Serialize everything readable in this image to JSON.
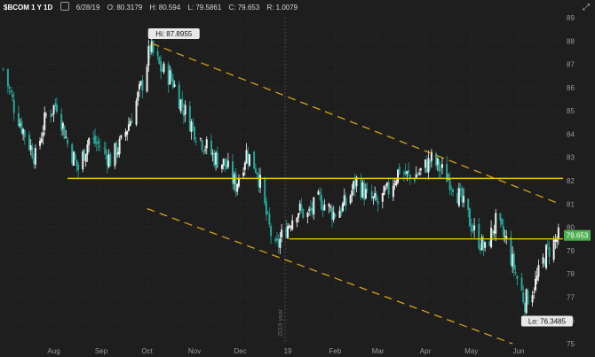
{
  "header": {
    "symbol": "$BCOM 1 Y 1D",
    "date": "6/28/19",
    "open": "O: 80.3179",
    "high": "H: 80.594",
    "low": "L: 79.5861",
    "close": "C: 79.653",
    "range": "R: 1.0079"
  },
  "colors": {
    "background": "#1e1e1e",
    "up": "#f0f0f0",
    "down": "#26a69a",
    "trendline": "#d4a017",
    "support": "#e6c200",
    "grid": "#3a3a3a",
    "price_tag": "#4caf50"
  },
  "chart_data": {
    "type": "candlestick",
    "title": "$BCOM 1 Y 1D",
    "ylim": [
      75,
      89
    ],
    "y_ticks": [
      75,
      76,
      77,
      78,
      79,
      80,
      81,
      82,
      83,
      84,
      85,
      86,
      87,
      88,
      89
    ],
    "x_labels": [
      {
        "label": "Aug",
        "date": "2018-08-01"
      },
      {
        "label": "Sep",
        "date": "2018-09-01"
      },
      {
        "label": "Oct",
        "date": "2018-10-01"
      },
      {
        "label": "Nov",
        "date": "2018-11-01"
      },
      {
        "label": "Dec",
        "date": "2018-12-01"
      },
      {
        "label": "19",
        "date": "2019-01-01"
      },
      {
        "label": "Feb",
        "date": "2019-02-01"
      },
      {
        "label": "Mar",
        "date": "2019-03-01"
      },
      {
        "label": "Apr",
        "date": "2019-04-01"
      },
      {
        "label": "May",
        "date": "2019-05-01"
      },
      {
        "label": "Jun",
        "date": "2019-06-01"
      }
    ],
    "year_marker": {
      "label": "2019 year",
      "date": "2019-01-01"
    },
    "price_path": [
      [
        "2018-06-29",
        86.8
      ],
      [
        "2018-07-06",
        85.2
      ],
      [
        "2018-07-13",
        84.0
      ],
      [
        "2018-07-20",
        83.0
      ],
      [
        "2018-07-27",
        84.8
      ],
      [
        "2018-08-03",
        85.3
      ],
      [
        "2018-08-10",
        83.6
      ],
      [
        "2018-08-17",
        82.5
      ],
      [
        "2018-08-24",
        83.8
      ],
      [
        "2018-08-31",
        83.5
      ],
      [
        "2018-09-07",
        82.9
      ],
      [
        "2018-09-14",
        83.6
      ],
      [
        "2018-09-21",
        84.8
      ],
      [
        "2018-09-28",
        86.2
      ],
      [
        "2018-10-03",
        87.7
      ],
      [
        "2018-10-10",
        86.8
      ],
      [
        "2018-10-17",
        86.4
      ],
      [
        "2018-10-24",
        85.2
      ],
      [
        "2018-10-31",
        84.3
      ],
      [
        "2018-11-07",
        83.6
      ],
      [
        "2018-11-14",
        83.0
      ],
      [
        "2018-11-21",
        82.7
      ],
      [
        "2018-11-28",
        81.8
      ],
      [
        "2018-12-05",
        83.2
      ],
      [
        "2018-12-12",
        82.5
      ],
      [
        "2018-12-19",
        80.2
      ],
      [
        "2018-12-24",
        79.0
      ],
      [
        "2018-12-28",
        79.6
      ],
      [
        "2019-01-07",
        80.8
      ],
      [
        "2019-01-14",
        80.5
      ],
      [
        "2019-01-22",
        81.2
      ],
      [
        "2019-01-31",
        80.6
      ],
      [
        "2019-02-08",
        81.0
      ],
      [
        "2019-02-15",
        82.0
      ],
      [
        "2019-02-22",
        81.3
      ],
      [
        "2019-03-01",
        81.0
      ],
      [
        "2019-03-08",
        81.6
      ],
      [
        "2019-03-15",
        82.5
      ],
      [
        "2019-03-22",
        82.1
      ],
      [
        "2019-03-29",
        82.4
      ],
      [
        "2019-04-05",
        82.9
      ],
      [
        "2019-04-12",
        82.4
      ],
      [
        "2019-04-19",
        81.9
      ],
      [
        "2019-04-26",
        80.9
      ],
      [
        "2019-05-03",
        79.8
      ],
      [
        "2019-05-10",
        79.0
      ],
      [
        "2019-05-17",
        80.2
      ],
      [
        "2019-05-24",
        79.4
      ],
      [
        "2019-05-31",
        77.8
      ],
      [
        "2019-06-05",
        76.8
      ],
      [
        "2019-06-12",
        77.6
      ],
      [
        "2019-06-19",
        78.9
      ],
      [
        "2019-06-28",
        79.65
      ]
    ],
    "trendlines": [
      {
        "name": "upper channel",
        "style": "dashed",
        "from": [
          "2018-10-04",
          87.9
        ],
        "to": [
          "2019-06-28",
          81.0
        ]
      },
      {
        "name": "lower channel",
        "style": "dashed",
        "from": [
          "2018-10-01",
          80.8
        ],
        "to": [
          "2019-05-28",
          75.0
        ]
      },
      {
        "name": "support 82.1",
        "style": "solid",
        "from": [
          "2018-08-10",
          82.1
        ],
        "to": [
          "2019-06-30",
          82.1
        ]
      },
      {
        "name": "support 79.5",
        "style": "solid",
        "from": [
          "2019-01-02",
          79.5
        ],
        "to": [
          "2019-06-30",
          79.5
        ]
      }
    ],
    "annotations": [
      {
        "text": "Hi: 87.8955",
        "date": "2018-10-04",
        "value": 87.8955
      },
      {
        "text": "Lo: 76.3485",
        "date": "2019-06-05",
        "value": 76.3485
      }
    ],
    "last_price": {
      "text": "79.653",
      "value": 79.653
    },
    "grid": true
  }
}
